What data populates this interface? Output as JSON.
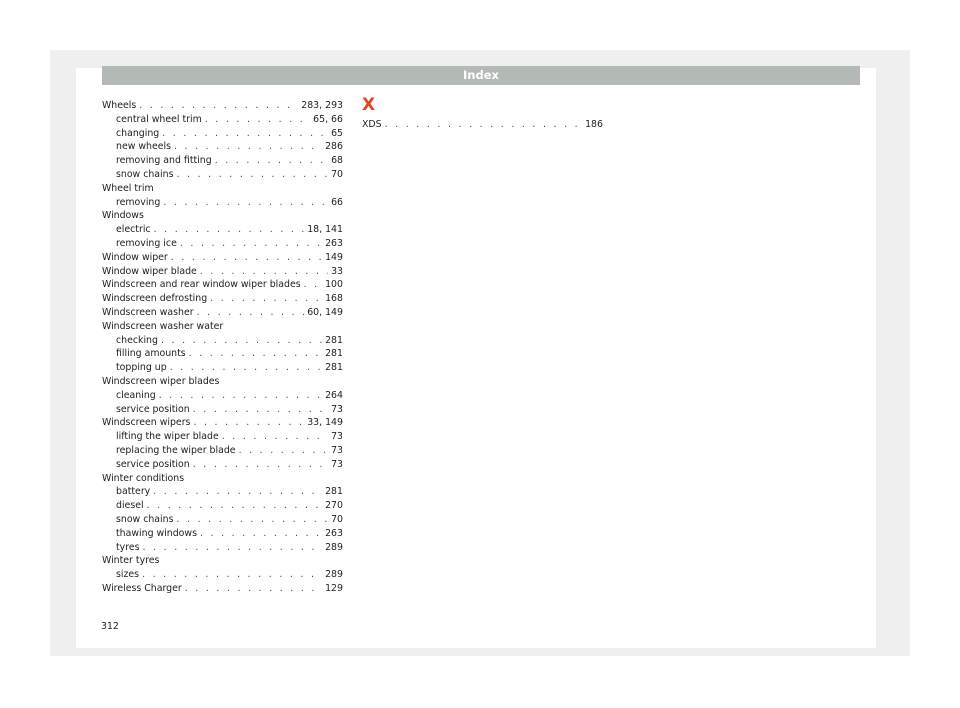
{
  "header": {
    "title": "Index"
  },
  "left_column": [
    {
      "type": "entry",
      "label": "Wheels",
      "pages": "283, 293"
    },
    {
      "type": "sub",
      "label": "central wheel trim",
      "pages": "65, 66"
    },
    {
      "type": "sub",
      "label": "changing",
      "pages": "65"
    },
    {
      "type": "sub",
      "label": "new wheels",
      "pages": "286"
    },
    {
      "type": "sub",
      "label": "removing and fitting",
      "pages": "68"
    },
    {
      "type": "sub",
      "label": "snow chains",
      "pages": "70"
    },
    {
      "type": "heading",
      "label": "Wheel trim"
    },
    {
      "type": "sub",
      "label": "removing",
      "pages": "66"
    },
    {
      "type": "heading",
      "label": "Windows"
    },
    {
      "type": "sub",
      "label": "electric",
      "pages": "18, 141"
    },
    {
      "type": "sub",
      "label": "removing ice",
      "pages": "263"
    },
    {
      "type": "entry",
      "label": "Window wiper",
      "pages": "149"
    },
    {
      "type": "entry",
      "label": "Window wiper blade",
      "pages": "33"
    },
    {
      "type": "entry",
      "label": "Windscreen and rear window wiper blades",
      "pages": "100"
    },
    {
      "type": "entry",
      "label": "Windscreen defrosting",
      "pages": "168"
    },
    {
      "type": "entry",
      "label": "Windscreen washer",
      "pages": "60, 149"
    },
    {
      "type": "heading",
      "label": "Windscreen washer water"
    },
    {
      "type": "sub",
      "label": "checking",
      "pages": "281"
    },
    {
      "type": "sub",
      "label": "filling amounts",
      "pages": "281"
    },
    {
      "type": "sub",
      "label": "topping up",
      "pages": "281"
    },
    {
      "type": "heading",
      "label": "Windscreen wiper blades"
    },
    {
      "type": "sub",
      "label": "cleaning",
      "pages": "264"
    },
    {
      "type": "sub",
      "label": "service position",
      "pages": "73"
    },
    {
      "type": "entry",
      "label": "Windscreen wipers",
      "pages": "33, 149"
    },
    {
      "type": "sub",
      "label": "lifting the wiper blade",
      "pages": "73"
    },
    {
      "type": "sub",
      "label": "replacing the wiper blade",
      "pages": "73"
    },
    {
      "type": "sub",
      "label": "service position",
      "pages": "73"
    },
    {
      "type": "heading",
      "label": "Winter conditions"
    },
    {
      "type": "sub",
      "label": "battery",
      "pages": "281"
    },
    {
      "type": "sub",
      "label": "diesel",
      "pages": "270"
    },
    {
      "type": "sub",
      "label": "snow chains",
      "pages": "70"
    },
    {
      "type": "sub",
      "label": "thawing windows",
      "pages": "263"
    },
    {
      "type": "sub",
      "label": "tyres",
      "pages": "289"
    },
    {
      "type": "heading",
      "label": "Winter tyres"
    },
    {
      "type": "sub",
      "label": "sizes",
      "pages": "289"
    },
    {
      "type": "entry",
      "label": "Wireless Charger",
      "pages": "129"
    }
  ],
  "right_column": [
    {
      "type": "letter",
      "label": "X"
    },
    {
      "type": "entry",
      "label": "XDS",
      "pages": "186"
    }
  ],
  "footer": {
    "page_number": "312"
  },
  "colors": {
    "header_band": "#b3b9b5",
    "letter_accent": "#e0452b"
  }
}
